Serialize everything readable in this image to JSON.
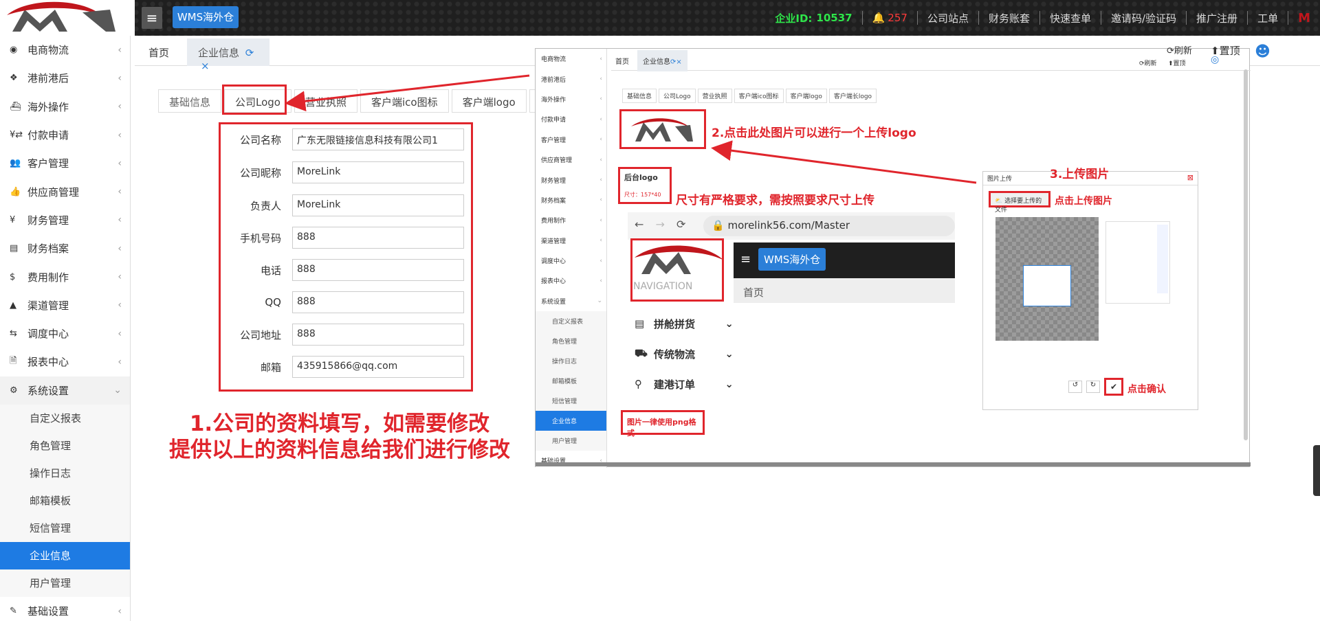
{
  "topbar": {
    "app_button": "WMS海外仓",
    "enterprise_id_label": "企业ID:",
    "enterprise_id_value": "10537",
    "notification_count": "257",
    "links": [
      "公司站点",
      "财务账套",
      "快速查单",
      "邀请码/验证码",
      "推广注册",
      "工单"
    ]
  },
  "sidebar": {
    "items": [
      {
        "label": "电商物流",
        "icon": "globe-icon"
      },
      {
        "label": "港前港后",
        "icon": "cubes-icon"
      },
      {
        "label": "海外操作",
        "icon": "ship-icon"
      },
      {
        "label": "付款申请",
        "icon": "yen-shuffle-icon"
      },
      {
        "label": "客户管理",
        "icon": "users-icon"
      },
      {
        "label": "供应商管理",
        "icon": "thumbs-up-icon"
      },
      {
        "label": "财务管理",
        "icon": "yen-icon"
      },
      {
        "label": "财务档案",
        "icon": "book-icon"
      },
      {
        "label": "费用制作",
        "icon": "dollar-icon"
      },
      {
        "label": "渠道管理",
        "icon": "road-icon"
      },
      {
        "label": "调度中心",
        "icon": "retweet-icon"
      },
      {
        "label": "报表中心",
        "icon": "file-icon"
      },
      {
        "label": "系统设置",
        "icon": "gear-icon"
      }
    ],
    "sub_items": [
      "自定义报表",
      "角色管理",
      "操作日志",
      "邮箱模板",
      "短信管理",
      "企业信息",
      "用户管理"
    ],
    "last_item": "基础设置",
    "active_sub": "企业信息"
  },
  "tabs": {
    "home": "首页",
    "current": "企业信息"
  },
  "subtabs": [
    "基础信息",
    "公司Logo",
    "营业执照",
    "客户端ico图标",
    "客户端logo",
    "客"
  ],
  "form": {
    "fields": [
      {
        "label": "公司名称",
        "value": "广东无限链接信息科技有限公司1"
      },
      {
        "label": "公司昵称",
        "value": "MoreLink"
      },
      {
        "label": "负责人",
        "value": "MoreLink"
      },
      {
        "label": "手机号码",
        "value": "888"
      },
      {
        "label": "电话",
        "value": "888"
      },
      {
        "label": "QQ",
        "value": "888"
      },
      {
        "label": "公司地址",
        "value": "888"
      },
      {
        "label": "邮箱",
        "value": "435915866@qq.com"
      }
    ]
  },
  "annotations": {
    "note1_line1": "1.公司的资料填写，如需要修改",
    "note1_line2": "提供以上的资料信息给我们进行修改",
    "note2": "2.点击此处图片可以进行一个上传logo",
    "note3": "3.上传图片",
    "size_note": "尺寸有严格要求，需按照要求尺寸上传",
    "upload_hint": "点击上传图片",
    "confirm_hint": "点击确认",
    "png_note": "图片一律使用png格式"
  },
  "embedded": {
    "home": "首页",
    "current_tab": "企业信息",
    "refresh": "刷新",
    "top": "置顶",
    "big_refresh": "刷新",
    "big_top": "置顶",
    "subtabs": [
      "基础信息",
      "公司Logo",
      "营业执照",
      "客户端ico图标",
      "客户端logo",
      "客户端长logo"
    ],
    "backend_logo_title": "后台logo",
    "size_label": "尺寸：157*40",
    "url": "morelink56.com/Master",
    "wms_button": "WMS海外仓",
    "home2": "首页",
    "nav_label": "NAVIGATION",
    "menu_items": [
      "拼舱拼货",
      "传统物流",
      "建港订单"
    ],
    "upload_title": "图片上传",
    "choose_file": "选择要上传的文件",
    "side_items": [
      "电商物流",
      "港前港后",
      "海外操作",
      "付款申请",
      "客户管理",
      "供应商管理",
      "财务管理",
      "财务档案",
      "费用制作",
      "渠道管理",
      "调度中心",
      "报表中心",
      "系统设置"
    ],
    "side_sub": [
      "自定义报表",
      "角色管理",
      "操作日志",
      "邮箱模板",
      "短信管理",
      "企业信息",
      "用户管理"
    ],
    "side_last": "基础设置"
  },
  "colors": {
    "accent": "#1e7be3",
    "annotation_red": "#e0252c",
    "topbar_bg": "#1f1f1f"
  }
}
